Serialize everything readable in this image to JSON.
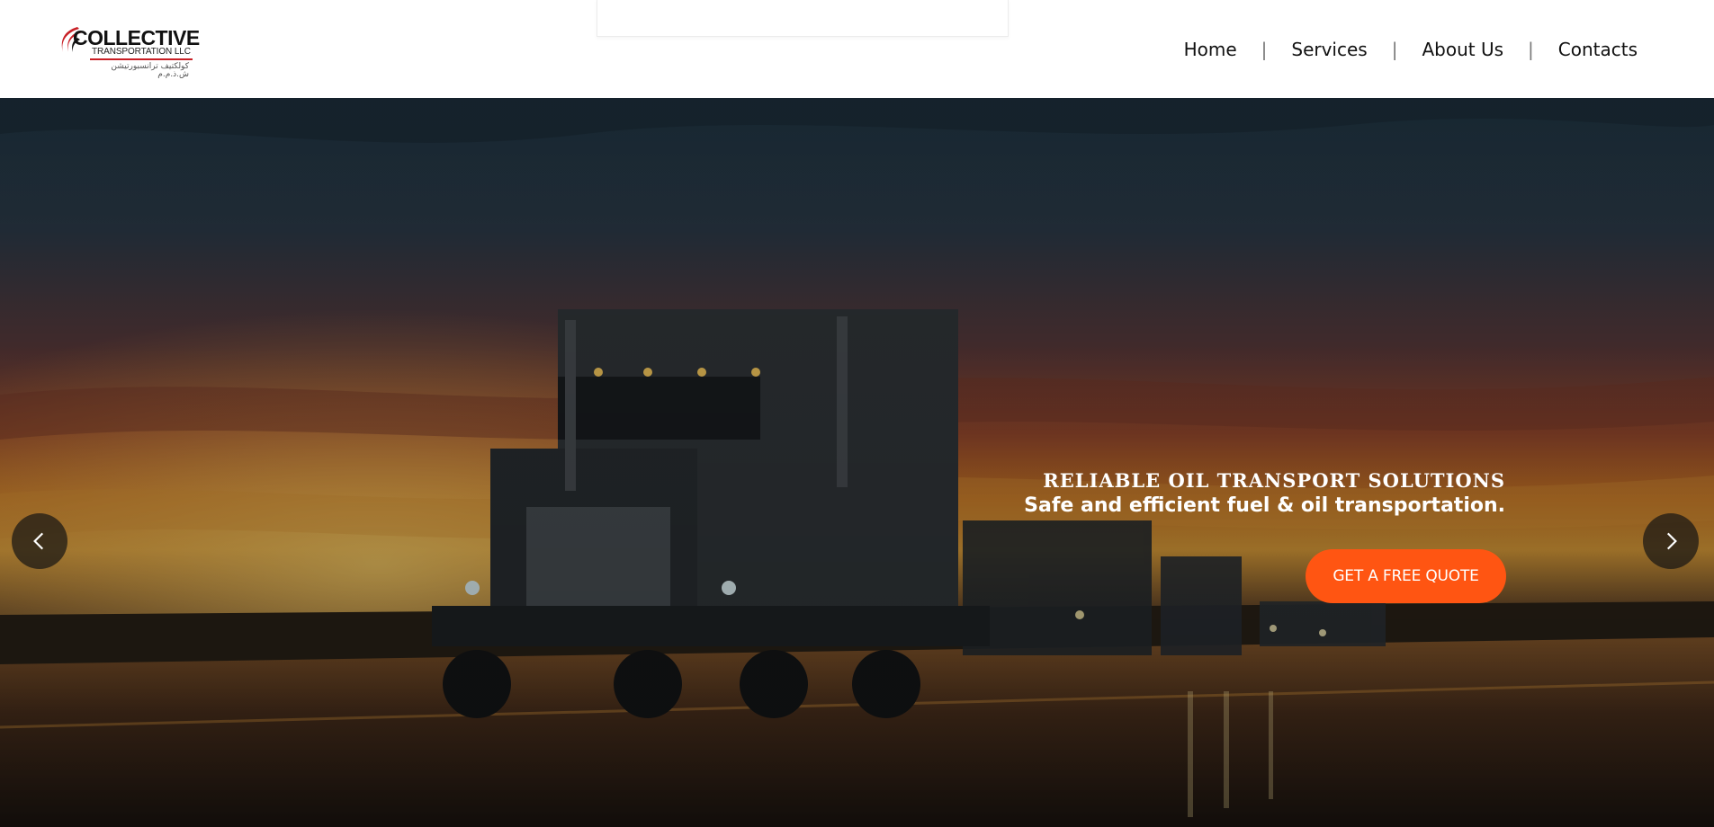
{
  "brand": {
    "name": "COLLECTIVE",
    "subtitle": "TRANSPORTATION LLC",
    "arabic_name": "كولكتيف ترانسبورتيشن ش.ذ.م.م",
    "logo_icon": "swoosh-logo-icon",
    "accent_color": "#c81f25"
  },
  "nav": {
    "items": [
      {
        "label": "Home"
      },
      {
        "label": "Services"
      },
      {
        "label": "About Us"
      },
      {
        "label": "Contacts"
      }
    ],
    "separator": "|"
  },
  "hero": {
    "title": "RELIABLE OIL TRANSPORT SOLUTIONS",
    "subtitle": "Safe and efficient fuel & oil transportation.",
    "cta_label": "GET A FREE QUOTE",
    "cta_color": "#ff5512",
    "prev_icon": "chevron-left-icon",
    "next_icon": "chevron-right-icon"
  }
}
